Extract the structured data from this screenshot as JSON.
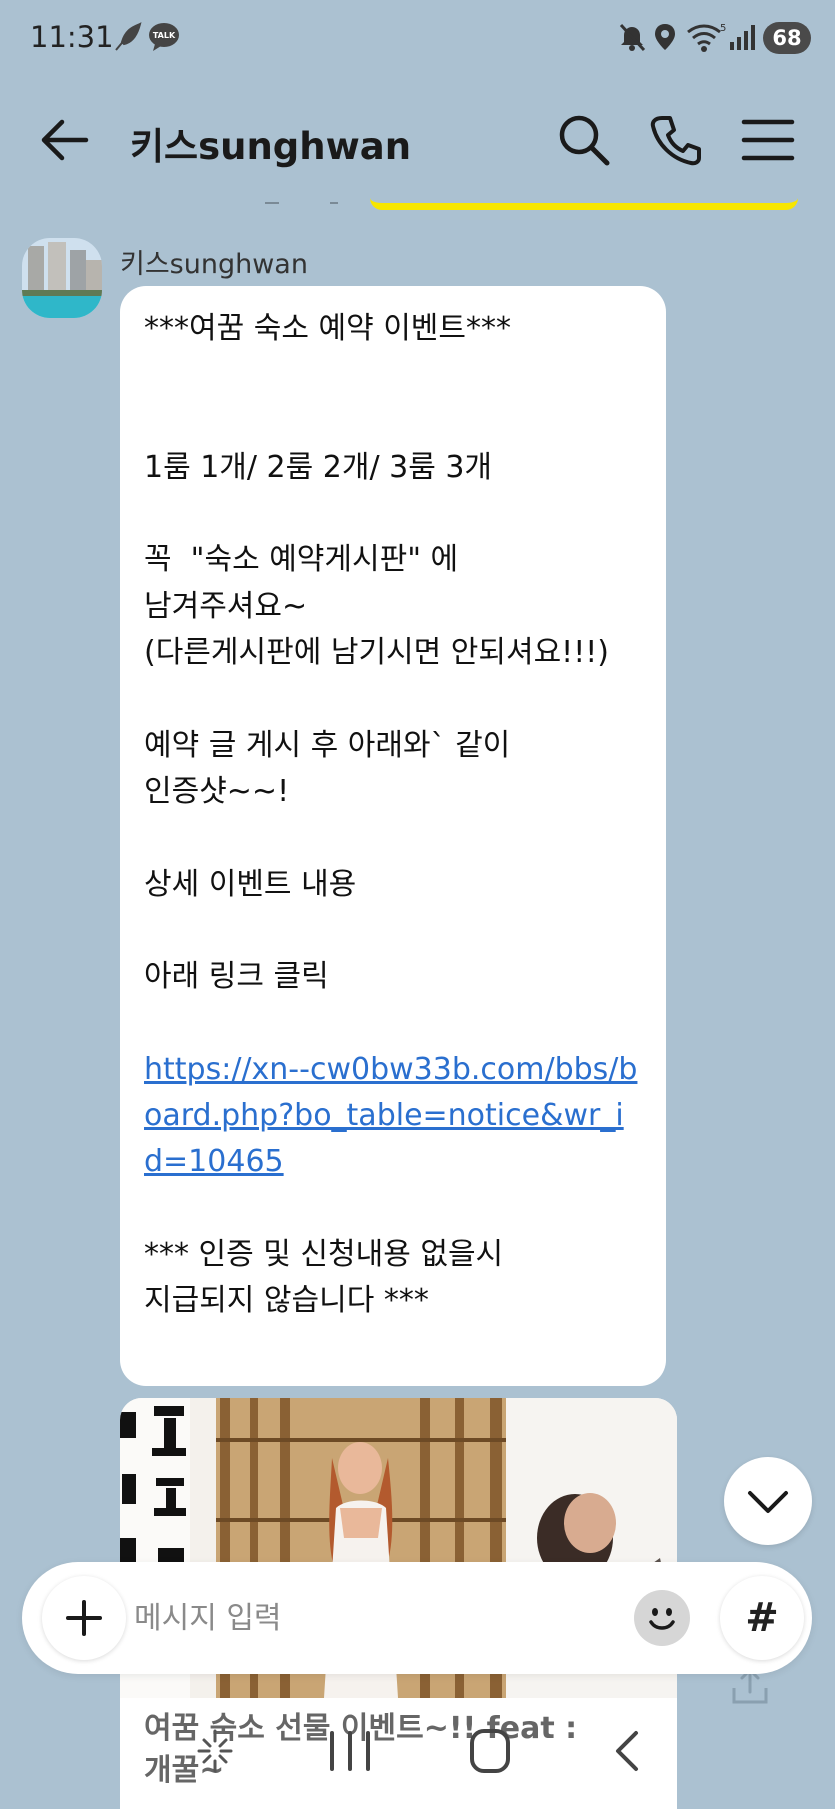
{
  "status_bar": {
    "time": "11:31",
    "battery": "68",
    "icons": [
      "feather-icon",
      "talk-icon",
      "mute-icon",
      "location-icon",
      "wifi-icon",
      "signal-icon"
    ]
  },
  "header": {
    "title": "키스sunghwan",
    "icons": [
      "back-arrow-icon",
      "search-icon",
      "phone-icon",
      "menu-icon"
    ]
  },
  "message": {
    "sender": "키스sunghwan",
    "text_before_link": "***여꿈 숙소 예약 이벤트***\n\n\n1룸 1개/ 2룸 2개/ 3룸 3개\n\n꼭  \"숙소 예약게시판\" 에\n남겨주셔요~\n(다른게시판에 남기시면 안되셔요!!!)\n\n예약 글 게시 후 아래와` 같이\n인증샷~~!\n\n상세 이벤트 내용\n\n아래 링크 클릭\n\n",
    "link": "https://xn--cw0bw33b.com/bbs/board.php?bo_table=notice&wr_id=10465",
    "text_after_link": "\n\n*** 인증 및 신청내용 없을시\n지급되지 않습니다 ***"
  },
  "image_card": {
    "caption": "여꿈 숙소 선물 이벤트~!! feat : 개꿀~"
  },
  "input": {
    "placeholder": "메시지 입력",
    "hash_label": "#"
  },
  "colors": {
    "background": "#abc1d1",
    "highlight": "#f7e600",
    "link": "#2a6fcf"
  }
}
